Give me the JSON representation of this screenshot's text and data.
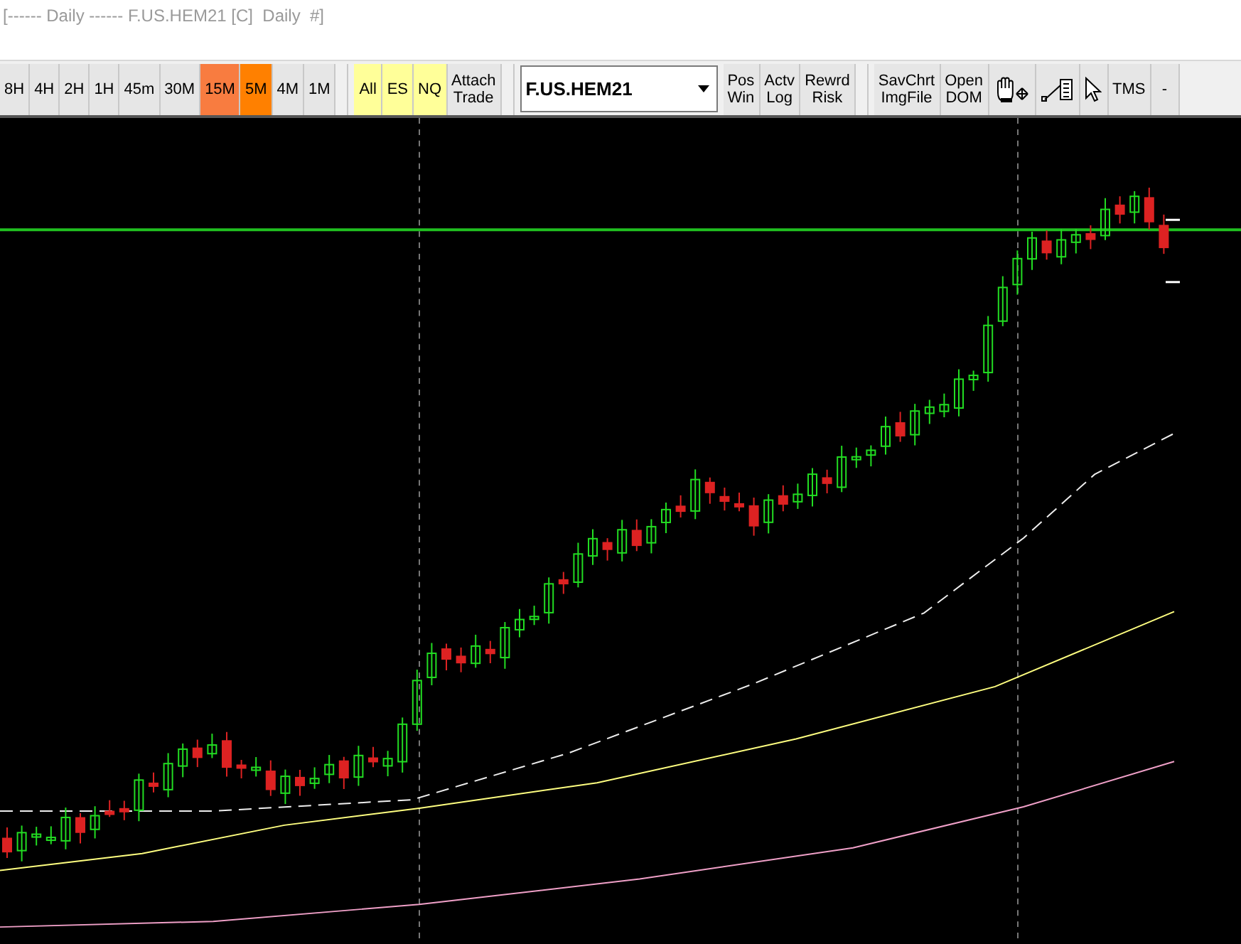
{
  "window": {
    "title": "[------ Daily ------ F.US.HEM21 [C]  Daily  #]"
  },
  "toolbar": {
    "groups": [
      {
        "buttons": [
          {
            "kind": "text",
            "label": "8H"
          },
          {
            "kind": "text",
            "label": "4H"
          },
          {
            "kind": "text",
            "label": "2H"
          },
          {
            "kind": "text",
            "label": "1H"
          },
          {
            "kind": "text",
            "label": "45m"
          },
          {
            "kind": "text",
            "label": "30M"
          },
          {
            "kind": "text",
            "label": "15M",
            "color": "#f87c40"
          },
          {
            "kind": "text",
            "label": "5M",
            "color": "#ff8000"
          },
          {
            "kind": "text",
            "label": "4M"
          },
          {
            "kind": "text",
            "label": "1M"
          }
        ]
      },
      {
        "buttons": [
          {
            "kind": "text",
            "label": "All",
            "color": "#ffff99"
          },
          {
            "kind": "text",
            "label": "ES",
            "color": "#ffff99"
          },
          {
            "kind": "text",
            "label": "NQ",
            "color": "#ffff99"
          },
          {
            "kind": "text",
            "label": "Attach\nTrade"
          }
        ]
      },
      {
        "buttons": [
          {
            "kind": "combo",
            "label": "F.US.HEM21"
          },
          {
            "kind": "text",
            "label": "Pos\nWin"
          },
          {
            "kind": "text",
            "label": "Actv\nLog"
          },
          {
            "kind": "text",
            "label": "Rewrd\nRisk"
          }
        ]
      },
      {
        "buttons": [
          {
            "kind": "text",
            "label": "SavChrt\nImgFile"
          },
          {
            "kind": "text",
            "label": "Open\nDOM"
          },
          {
            "kind": "hand"
          },
          {
            "kind": "drawtool"
          },
          {
            "kind": "pointer"
          },
          {
            "kind": "text",
            "label": "TMS"
          },
          {
            "kind": "text",
            "label": "-"
          }
        ]
      }
    ]
  }
}
